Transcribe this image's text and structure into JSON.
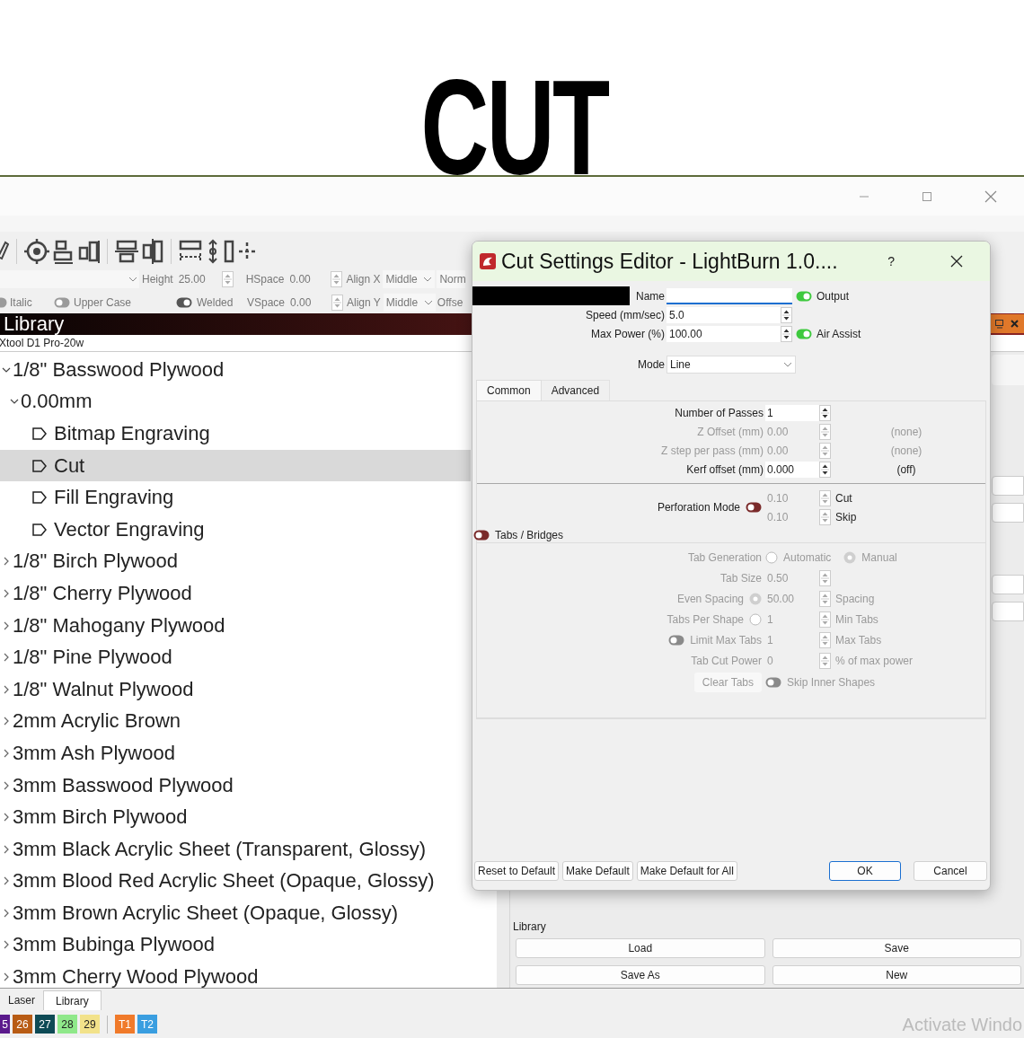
{
  "headline": "CUT",
  "text_options": {
    "height": {
      "label": "Height",
      "value": "25.00"
    },
    "hspace": {
      "label": "HSpace",
      "value": "0.00"
    },
    "align_x": {
      "label": "Align X",
      "value": "Middle"
    },
    "column_5_row_1": "Norm",
    "italic": {
      "label": "Italic",
      "on": false
    },
    "upper_case": {
      "label": "Upper Case",
      "on": false
    },
    "welded": {
      "label": "Welded",
      "on": true
    },
    "vspace": {
      "label": "VSpace",
      "value": "0.00"
    },
    "align_y": {
      "label": "Align Y",
      "value": "Middle"
    },
    "column_5_row_2": "Offse"
  },
  "library_panel": {
    "title": "Library",
    "device": "Xtool D1 Pro-20w",
    "tree": [
      {
        "label": "1/8\" Basswood Plywood",
        "expanded": true,
        "selected": false,
        "children": [
          {
            "label": "0.00mm",
            "expanded": true,
            "selected": false,
            "children": [
              {
                "label": "Bitmap Engraving",
                "selected": false
              },
              {
                "label": "Cut",
                "selected": true
              },
              {
                "label": "Fill Engraving",
                "selected": false
              },
              {
                "label": "Vector Engraving",
                "selected": false
              }
            ]
          }
        ]
      },
      {
        "label": "1/8\" Birch Plywood",
        "expanded": false,
        "selected": false
      },
      {
        "label": "1/8\" Cherry Plywood",
        "expanded": false,
        "selected": false
      },
      {
        "label": "1/8\" Mahogany Plywood",
        "expanded": false,
        "selected": false
      },
      {
        "label": "1/8\" Pine Plywood",
        "expanded": false,
        "selected": false
      },
      {
        "label": "1/8\" Walnut Plywood",
        "expanded": false,
        "selected": false
      },
      {
        "label": "2mm Acrylic Brown",
        "expanded": false,
        "selected": false
      },
      {
        "label": "3mm Ash Plywood",
        "expanded": false,
        "selected": false
      },
      {
        "label": "3mm Basswood Plywood",
        "expanded": false,
        "selected": false
      },
      {
        "label": "3mm Birch Plywood",
        "expanded": false,
        "selected": false
      },
      {
        "label": "3mm Black Acrylic Sheet (Transparent, Glossy)",
        "expanded": false,
        "selected": false
      },
      {
        "label": "3mm Blood Red Acrylic Sheet (Opaque, Glossy)",
        "expanded": false,
        "selected": false
      },
      {
        "label": "3mm Brown Acrylic Sheet (Opaque, Glossy)",
        "expanded": false,
        "selected": false
      },
      {
        "label": "3mm Bubinga Plywood",
        "expanded": false,
        "selected": false
      },
      {
        "label": "3mm Cherry Wood Plywood",
        "expanded": false,
        "selected": false
      }
    ]
  },
  "library_group": {
    "title": "Library",
    "buttons": [
      "Load",
      "Save",
      "Save As",
      "New"
    ]
  },
  "bottom_tabs": [
    {
      "label": "Laser",
      "selected": false
    },
    {
      "label": "Library",
      "selected": true
    }
  ],
  "palette": [
    {
      "label": "5",
      "color": "#5b1a8c"
    },
    {
      "label": "26",
      "color": "#b85c14"
    },
    {
      "label": "27",
      "color": "#0e4a55"
    },
    {
      "label": "28",
      "color": "#8fe88a"
    },
    {
      "label": "29",
      "color": "#f2e28a"
    },
    {
      "label": "T1",
      "color": "#f07a2a"
    },
    {
      "label": "T2",
      "color": "#3a9ee0"
    }
  ],
  "os_notice": "Activate Windo",
  "dialog": {
    "title": "Cut Settings Editor - LightBurn 1.0....",
    "help": "?",
    "name": {
      "label": "Name"
    },
    "output": {
      "label": "Output",
      "on": true
    },
    "speed": {
      "label": "Speed (mm/sec)",
      "value": "5.0"
    },
    "max_power": {
      "label": "Max Power (%)",
      "value": "100.00"
    },
    "air_assist": {
      "label": "Air Assist",
      "on": true
    },
    "mode": {
      "label": "Mode",
      "value": "Line"
    },
    "tabs": [
      {
        "label": "Common",
        "selected": true
      },
      {
        "label": "Advanced",
        "selected": false
      }
    ],
    "common_rows": [
      {
        "label": "Number of Passes",
        "value": "1",
        "disabled": false
      },
      {
        "label": "Z Offset (mm)",
        "value": "0.00",
        "note": "(none)",
        "disabled": true
      },
      {
        "label": "Z step per pass (mm)",
        "value": "0.00",
        "note": "(none)",
        "disabled": true
      },
      {
        "label": "Kerf offset (mm)",
        "value": "0.000",
        "note": "(off)",
        "disabled": false
      }
    ],
    "perforation": {
      "label": "Perforation Mode",
      "on": false,
      "rows": [
        {
          "value": "0.10",
          "unit": "Cut"
        },
        {
          "value": "0.10",
          "unit": "Skip"
        }
      ]
    },
    "tabs_bridges": {
      "label": "Tabs / Bridges",
      "on": false,
      "tab_generation": {
        "label": "Tab Generation",
        "options": [
          {
            "label": "Automatic",
            "selected": false
          },
          {
            "label": "Manual",
            "selected": true
          }
        ]
      },
      "rows": [
        {
          "kind": "plain",
          "label": "Tab Size",
          "value": "0.50"
        },
        {
          "kind": "radio",
          "label": "Even Spacing",
          "selected": true,
          "value": "50.00",
          "unit": "Spacing"
        },
        {
          "kind": "radio",
          "label": "Tabs Per Shape",
          "selected": false,
          "value": "1",
          "unit": "Min Tabs"
        },
        {
          "kind": "toggle",
          "label": "Limit Max Tabs",
          "on": false,
          "value": "1",
          "unit": "Max Tabs"
        },
        {
          "kind": "plain",
          "label": "Tab Cut Power",
          "value": "0",
          "unit": "% of max power"
        }
      ],
      "clear_button": "Clear Tabs",
      "skip_inner": {
        "label": "Skip Inner Shapes",
        "on": false
      }
    },
    "footer_buttons": [
      {
        "label": "Reset to Default",
        "kind": "plain"
      },
      {
        "label": "Make Default",
        "kind": "plain"
      },
      {
        "label": "Make Default for All",
        "kind": "plain"
      },
      {
        "label": "OK",
        "kind": "default"
      },
      {
        "label": "Cancel",
        "kind": "plain"
      }
    ]
  }
}
